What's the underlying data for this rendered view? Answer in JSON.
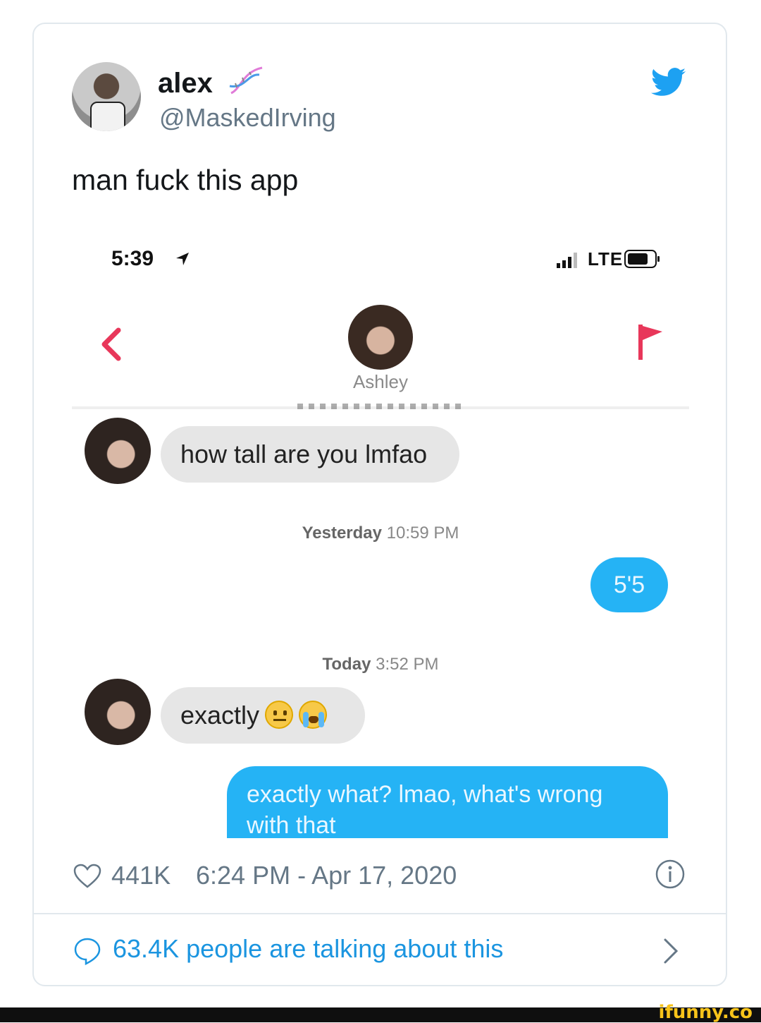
{
  "tweet": {
    "display_name": "alex",
    "handle": "@MaskedIrving",
    "text": "man fuck this app",
    "likes": "441K",
    "datetime": "6:24 PM - Apr 17, 2020",
    "talking": "63.4K people are talking about this",
    "icons": [
      "dna-icon",
      "twitter-bird-icon",
      "heart-icon",
      "info-icon",
      "speech-bubble-icon",
      "chevron-right-icon"
    ],
    "colors": {
      "accent": "#1da1f2",
      "link": "#1b95e0",
      "muted": "#657786"
    }
  },
  "screenshot": {
    "status": {
      "time": "5:39",
      "network": "LTE"
    },
    "contact_name": "Ashley",
    "messages": [
      {
        "from": "them",
        "text": "how tall are you lmfao"
      },
      {
        "timestamp_day": "Yesterday",
        "timestamp_time": "10:59 PM"
      },
      {
        "from": "me",
        "text": "5'5"
      },
      {
        "timestamp_day": "Today",
        "timestamp_time": "3:52 PM"
      },
      {
        "from": "them",
        "text": "exactly"
      },
      {
        "from": "me",
        "text_line1": "exactly what? lmao, what's wrong",
        "text_line2": "with that"
      }
    ],
    "colors": {
      "incoming_bubble": "#e6e6e6",
      "outgoing_bubble": "#25b3f5",
      "nav_accent": "#e8375a"
    }
  },
  "watermark": "ifunny.co"
}
